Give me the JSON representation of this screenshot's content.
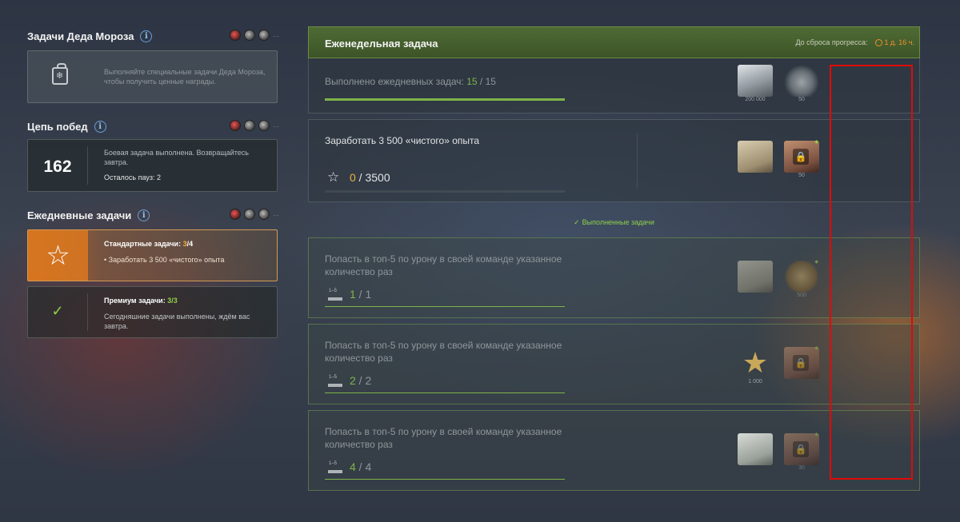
{
  "left": {
    "ded_moroz": {
      "title": "Задачи Деда Мороза",
      "info": "i",
      "icons": [
        "tank-badge-icon",
        "tank-badge-icon",
        "tank-badge-icon"
      ],
      "text": "Выполняйте специальные задачи Деда Мороза, чтобы получить ценные награды."
    },
    "chain": {
      "title": "Цепь побед",
      "info": "i",
      "value": "162",
      "text": "Боевая задача выполнена. Возвращайтесь завтра.",
      "pauses": "Осталось пауз: 2"
    },
    "daily": {
      "title": "Ежедневные задачи",
      "info": "i",
      "standard": {
        "label": "Стандартные задачи: ",
        "done": "3",
        "total": "/4",
        "item": "• Заработать 3 500 «чистого» опыта"
      },
      "premium": {
        "label": "Премиум задачи: ",
        "done": "3",
        "total": "/3",
        "text": "Сегодняшние задачи выполнены, ждём вас завтра."
      }
    }
  },
  "right": {
    "weekly": {
      "title": "Еженедельная задача",
      "reset_label": "До сброса прогресса:",
      "reset_time": "1 д. 16 ч.",
      "label": "Выполнено ежедневных задач: ",
      "done": "15",
      "total": " / 15",
      "progress": 1.0,
      "rewards": [
        {
          "icon": "silver-icon",
          "value": "200 000"
        },
        {
          "icon": "gears-icon",
          "value": "50"
        }
      ]
    },
    "xp_task": {
      "title": "Заработать 3 500 «чистого» опыта",
      "done": "0",
      "total": " / 3500",
      "rewards": [
        {
          "icon": "docs-icon",
          "value": ""
        },
        {
          "icon": "crates-icon",
          "value": "50"
        }
      ]
    },
    "done_label": "Выполненные задачи",
    "completed": [
      {
        "title": "Попасть в топ-5 по урону в своей команде указанное количество раз",
        "done": "1",
        "total": " / 1",
        "rewards": [
          {
            "icon": "cash-icon",
            "value": ""
          },
          {
            "icon": "star-icon",
            "value": "500"
          }
        ]
      },
      {
        "title": "Попасть в топ-5 по урону в своей команде указанное количество раз",
        "done": "2",
        "total": " / 2",
        "rewards": [
          {
            "icon": "star-icon",
            "value": "1 000"
          },
          {
            "icon": "crates-icon",
            "value": ""
          }
        ]
      },
      {
        "title": "Попасть в топ-5 по урону в своей команде указанное количество раз",
        "done": "4",
        "total": " / 4",
        "rewards": [
          {
            "icon": "note-icon",
            "value": ""
          },
          {
            "icon": "crates-icon",
            "value": "30"
          }
        ]
      }
    ]
  },
  "colors": {
    "accent_green": "#7fb34a",
    "accent_orange": "#f0b040",
    "timer_orange": "#f09030",
    "highlight_red": "#e00a0a"
  }
}
